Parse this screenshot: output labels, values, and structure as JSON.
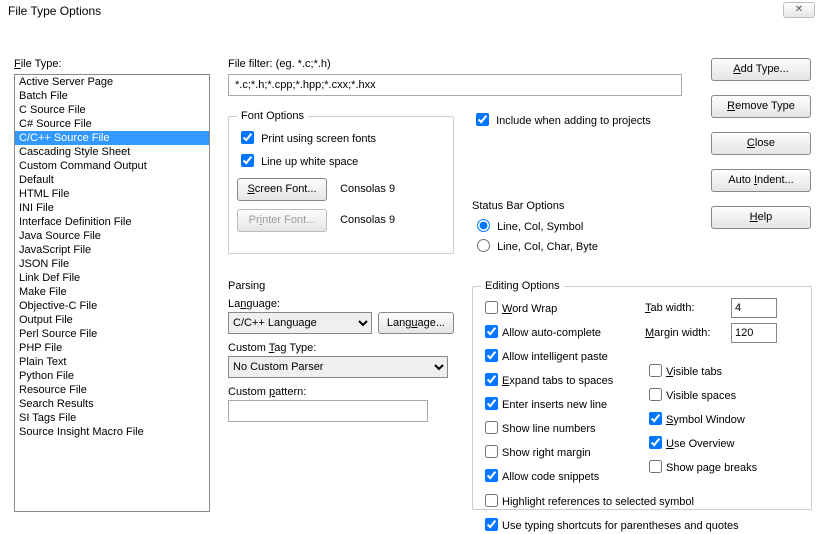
{
  "window": {
    "title": "File Type Options"
  },
  "labels": {
    "file_type": "File Type:",
    "file_filter": "File filter: (eg. *.c;*.h)"
  },
  "filter_value": "*.c;*.h;*.cpp;*.hpp;*.cxx;*.hxx",
  "buttons": {
    "add_type": "Add Type...",
    "remove_type": "Remove Type",
    "close": "Close",
    "auto_indent": "Auto Indent...",
    "help": "Help",
    "screen_font": "Screen Font...",
    "printer_font": "Printer Font...",
    "language": "Language..."
  },
  "file_types": {
    "items": [
      "Active Server Page",
      "Batch File",
      "C Source File",
      "C# Source File",
      "C/C++ Source File",
      "Cascading Style Sheet",
      "Custom Command Output",
      "Default",
      "HTML File",
      "INI File",
      "Interface Definition File",
      "Java Source File",
      "JavaScript File",
      "JSON File",
      "Link Def File",
      "Make File",
      "Objective-C File",
      "Output File",
      "Perl Source File",
      "PHP File",
      "Plain Text",
      "Python File",
      "Resource File",
      "Search Results",
      "SI Tags File",
      "Source Insight Macro File"
    ],
    "selected_index": 4
  },
  "font_options": {
    "legend": "Font Options",
    "print_screen_fonts": {
      "label": "Print using screen fonts",
      "checked": true
    },
    "lineup_whitespace": {
      "label": "Line up white space",
      "checked": true
    },
    "screen_font_value": "Consolas 9",
    "printer_font_value": "Consolas 9"
  },
  "include_projects": {
    "label": "Include when adding to projects",
    "checked": true
  },
  "status_bar": {
    "title": "Status Bar Options",
    "opt1": "Line, Col, Symbol",
    "opt2": "Line, Col, Char, Byte",
    "selected": 0
  },
  "parsing": {
    "title": "Parsing",
    "language_label": "Language:",
    "language_value": "C/C++ Language",
    "custom_tag_label": "Custom Tag Type:",
    "custom_tag_value": "No Custom Parser",
    "custom_pattern_label": "Custom pattern:",
    "custom_pattern_value": ""
  },
  "editing": {
    "legend": "Editing Options",
    "left": [
      {
        "label": "Word Wrap",
        "checked": false,
        "u": 0
      },
      {
        "label": "Allow auto-complete",
        "checked": true
      },
      {
        "label": "Allow intelligent paste",
        "checked": true
      },
      {
        "label": "Expand tabs to spaces",
        "checked": true,
        "u": 0
      },
      {
        "label": "Enter inserts new line",
        "checked": true
      },
      {
        "label": "Show line numbers",
        "checked": false
      },
      {
        "label": "Show right margin",
        "checked": false
      },
      {
        "label": "Allow code snippets",
        "checked": true
      }
    ],
    "tab_width": {
      "label": "Tab width:",
      "value": "4",
      "u": 0
    },
    "margin_width": {
      "label": "Margin width:",
      "value": "120"
    },
    "right": [
      {
        "label": "Visible tabs",
        "checked": false,
        "u": 0
      },
      {
        "label": "Visible spaces",
        "checked": false
      },
      {
        "label": "Symbol Window",
        "checked": true,
        "u": 0
      },
      {
        "label": "Use Overview",
        "checked": true,
        "u": 0
      },
      {
        "label": "Show page breaks",
        "checked": false
      }
    ],
    "full": [
      {
        "label": "Highlight references to selected symbol",
        "checked": false
      },
      {
        "label": "Use typing shortcuts for parentheses and quotes",
        "checked": true
      }
    ]
  }
}
